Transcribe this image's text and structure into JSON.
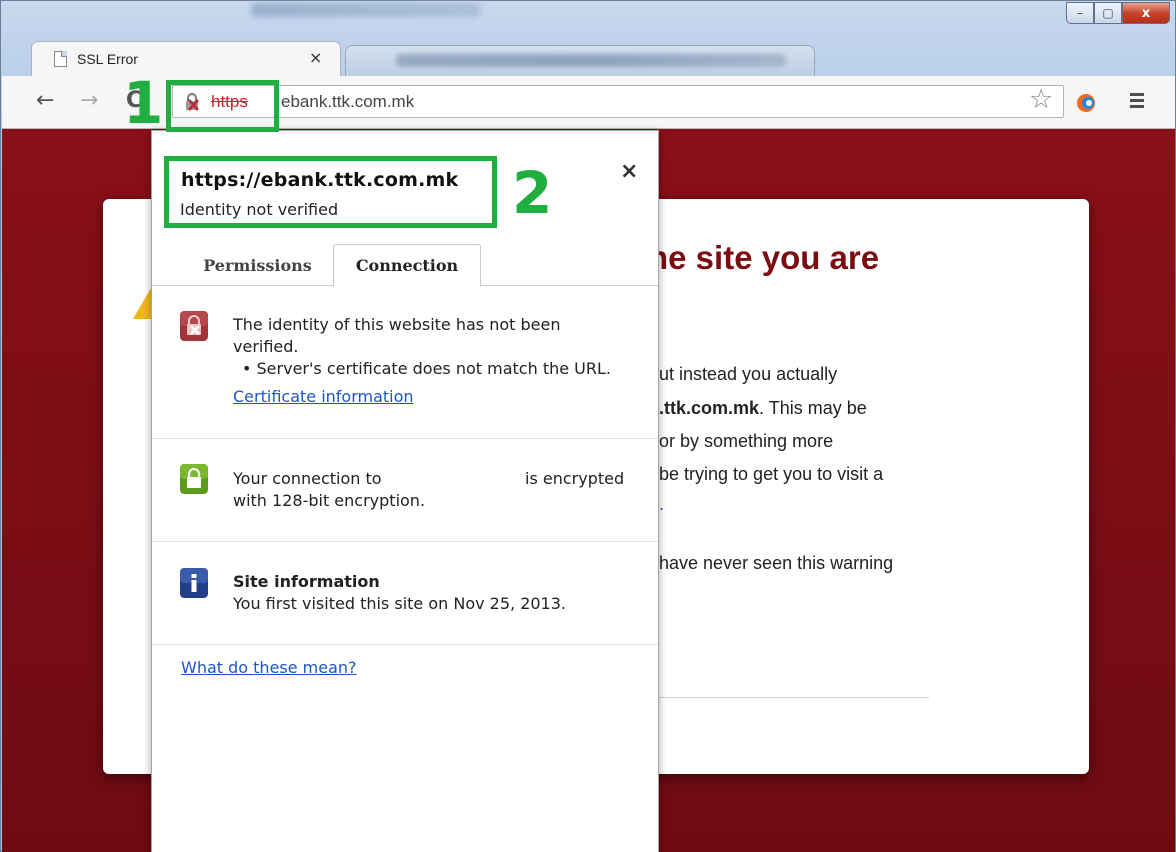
{
  "window": {
    "minimize_icon": "minimize-icon",
    "maximize_icon": "maximize-icon",
    "close_icon": "close-icon",
    "min_glyph": "–",
    "max_glyph": "▢",
    "close_glyph": "x"
  },
  "tabs": [
    {
      "title": "SSL Error",
      "close": "×"
    }
  ],
  "toolbar": {
    "back": "←",
    "forward": "→",
    "reload": "C",
    "scheme": "https",
    "url_rest": "ebank.ttk.com.mk",
    "star": "☆"
  },
  "page": {
    "heading": "he site you are",
    "lines": [
      {
        "text": "ut instead you actually",
        "bold": ""
      },
      {
        "text": ". This may be",
        "bold": ".ttk.com.mk"
      },
      {
        "text": "or by something more",
        "bold": ""
      },
      {
        "text": "be trying to get you to visit a",
        "bold": ""
      },
      {
        "text": "have never seen this warning",
        "bold": ""
      }
    ],
    "link_fragment": "."
  },
  "popup": {
    "host": "https://ebank.ttk.com.mk",
    "subtitle": "Identity not verified",
    "close": "×",
    "tabs": {
      "permissions": "Permissions",
      "connection": "Connection"
    },
    "identity": {
      "line1": "The identity of this website has not been",
      "line2": "verified.",
      "line3": "• Server's certificate does not match the URL.",
      "link": "Certificate information"
    },
    "connection": {
      "line1_a": "Your connection to",
      "line1_b": "is encrypted",
      "line2": "with 128-bit encryption."
    },
    "site_info": {
      "title": "Site information",
      "text": "You first visited this site on Nov 25, 2013."
    },
    "what_link": "What do these mean?"
  },
  "annotations": {
    "one": "1",
    "two": "2"
  },
  "colors": {
    "accent_green": "#1fae3f",
    "error_red": "#c1272d",
    "link_blue": "#1a56c8",
    "page_bg": "#8a0f18"
  }
}
